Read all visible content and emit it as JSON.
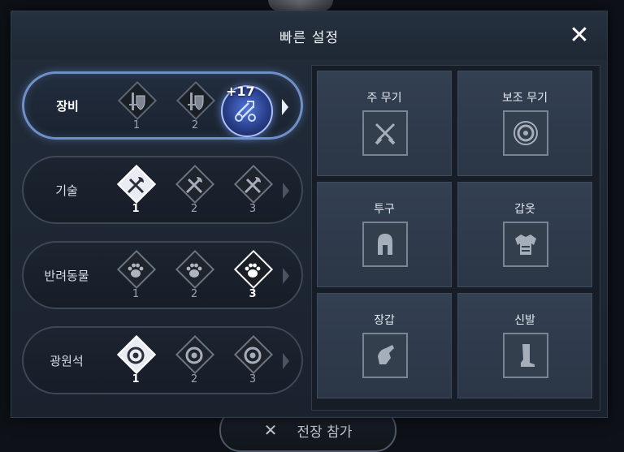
{
  "panel": {
    "title": "빠른 설정"
  },
  "bottom": {
    "label": "전장 참가"
  },
  "rows": [
    {
      "label": "장비",
      "slots": [
        "1",
        "2",
        ""
      ],
      "gear_level": "+17"
    },
    {
      "label": "기술",
      "slots": [
        "1",
        "2",
        "3"
      ]
    },
    {
      "label": "반려동물",
      "slots": [
        "1",
        "2",
        "3"
      ]
    },
    {
      "label": "광원석",
      "slots": [
        "1",
        "2",
        "3"
      ]
    }
  ],
  "equipment": [
    {
      "label": "주 무기",
      "icon": "crossed-swords-icon"
    },
    {
      "label": "보조 무기",
      "icon": "round-shield-icon"
    },
    {
      "label": "투구",
      "icon": "helmet-icon"
    },
    {
      "label": "갑옷",
      "icon": "armor-icon"
    },
    {
      "label": "장갑",
      "icon": "gauntlet-icon"
    },
    {
      "label": "신발",
      "icon": "boot-icon"
    }
  ],
  "colors": {
    "accent": "#6f90c6",
    "panel": "#1e2733"
  }
}
